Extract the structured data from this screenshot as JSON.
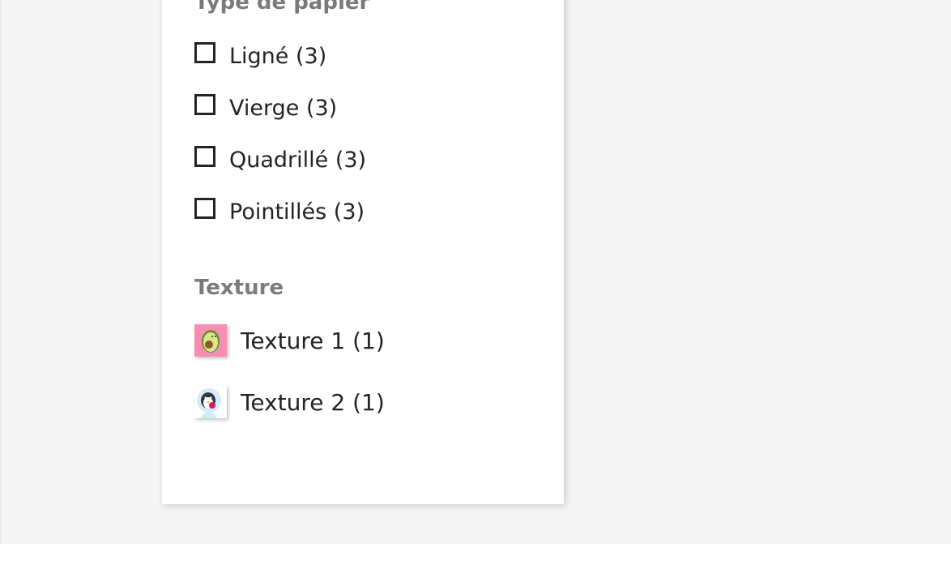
{
  "facets": {
    "paper_type": {
      "title": "Type de papier",
      "options": [
        {
          "label": "Ligné (3)",
          "checked": false
        },
        {
          "label": "Vierge (3)",
          "checked": false
        },
        {
          "label": "Quadrillé (3)",
          "checked": false
        },
        {
          "label": "Pointillés (3)",
          "checked": false
        }
      ]
    },
    "texture": {
      "title": "Texture",
      "options": [
        {
          "label": "Texture 1 (1)",
          "icon": "avocado-icon",
          "swatch_color": "#f48fb1"
        },
        {
          "label": "Texture 2 (1)",
          "icon": "penguin-icon",
          "swatch_color": "#ffffff"
        }
      ]
    }
  }
}
